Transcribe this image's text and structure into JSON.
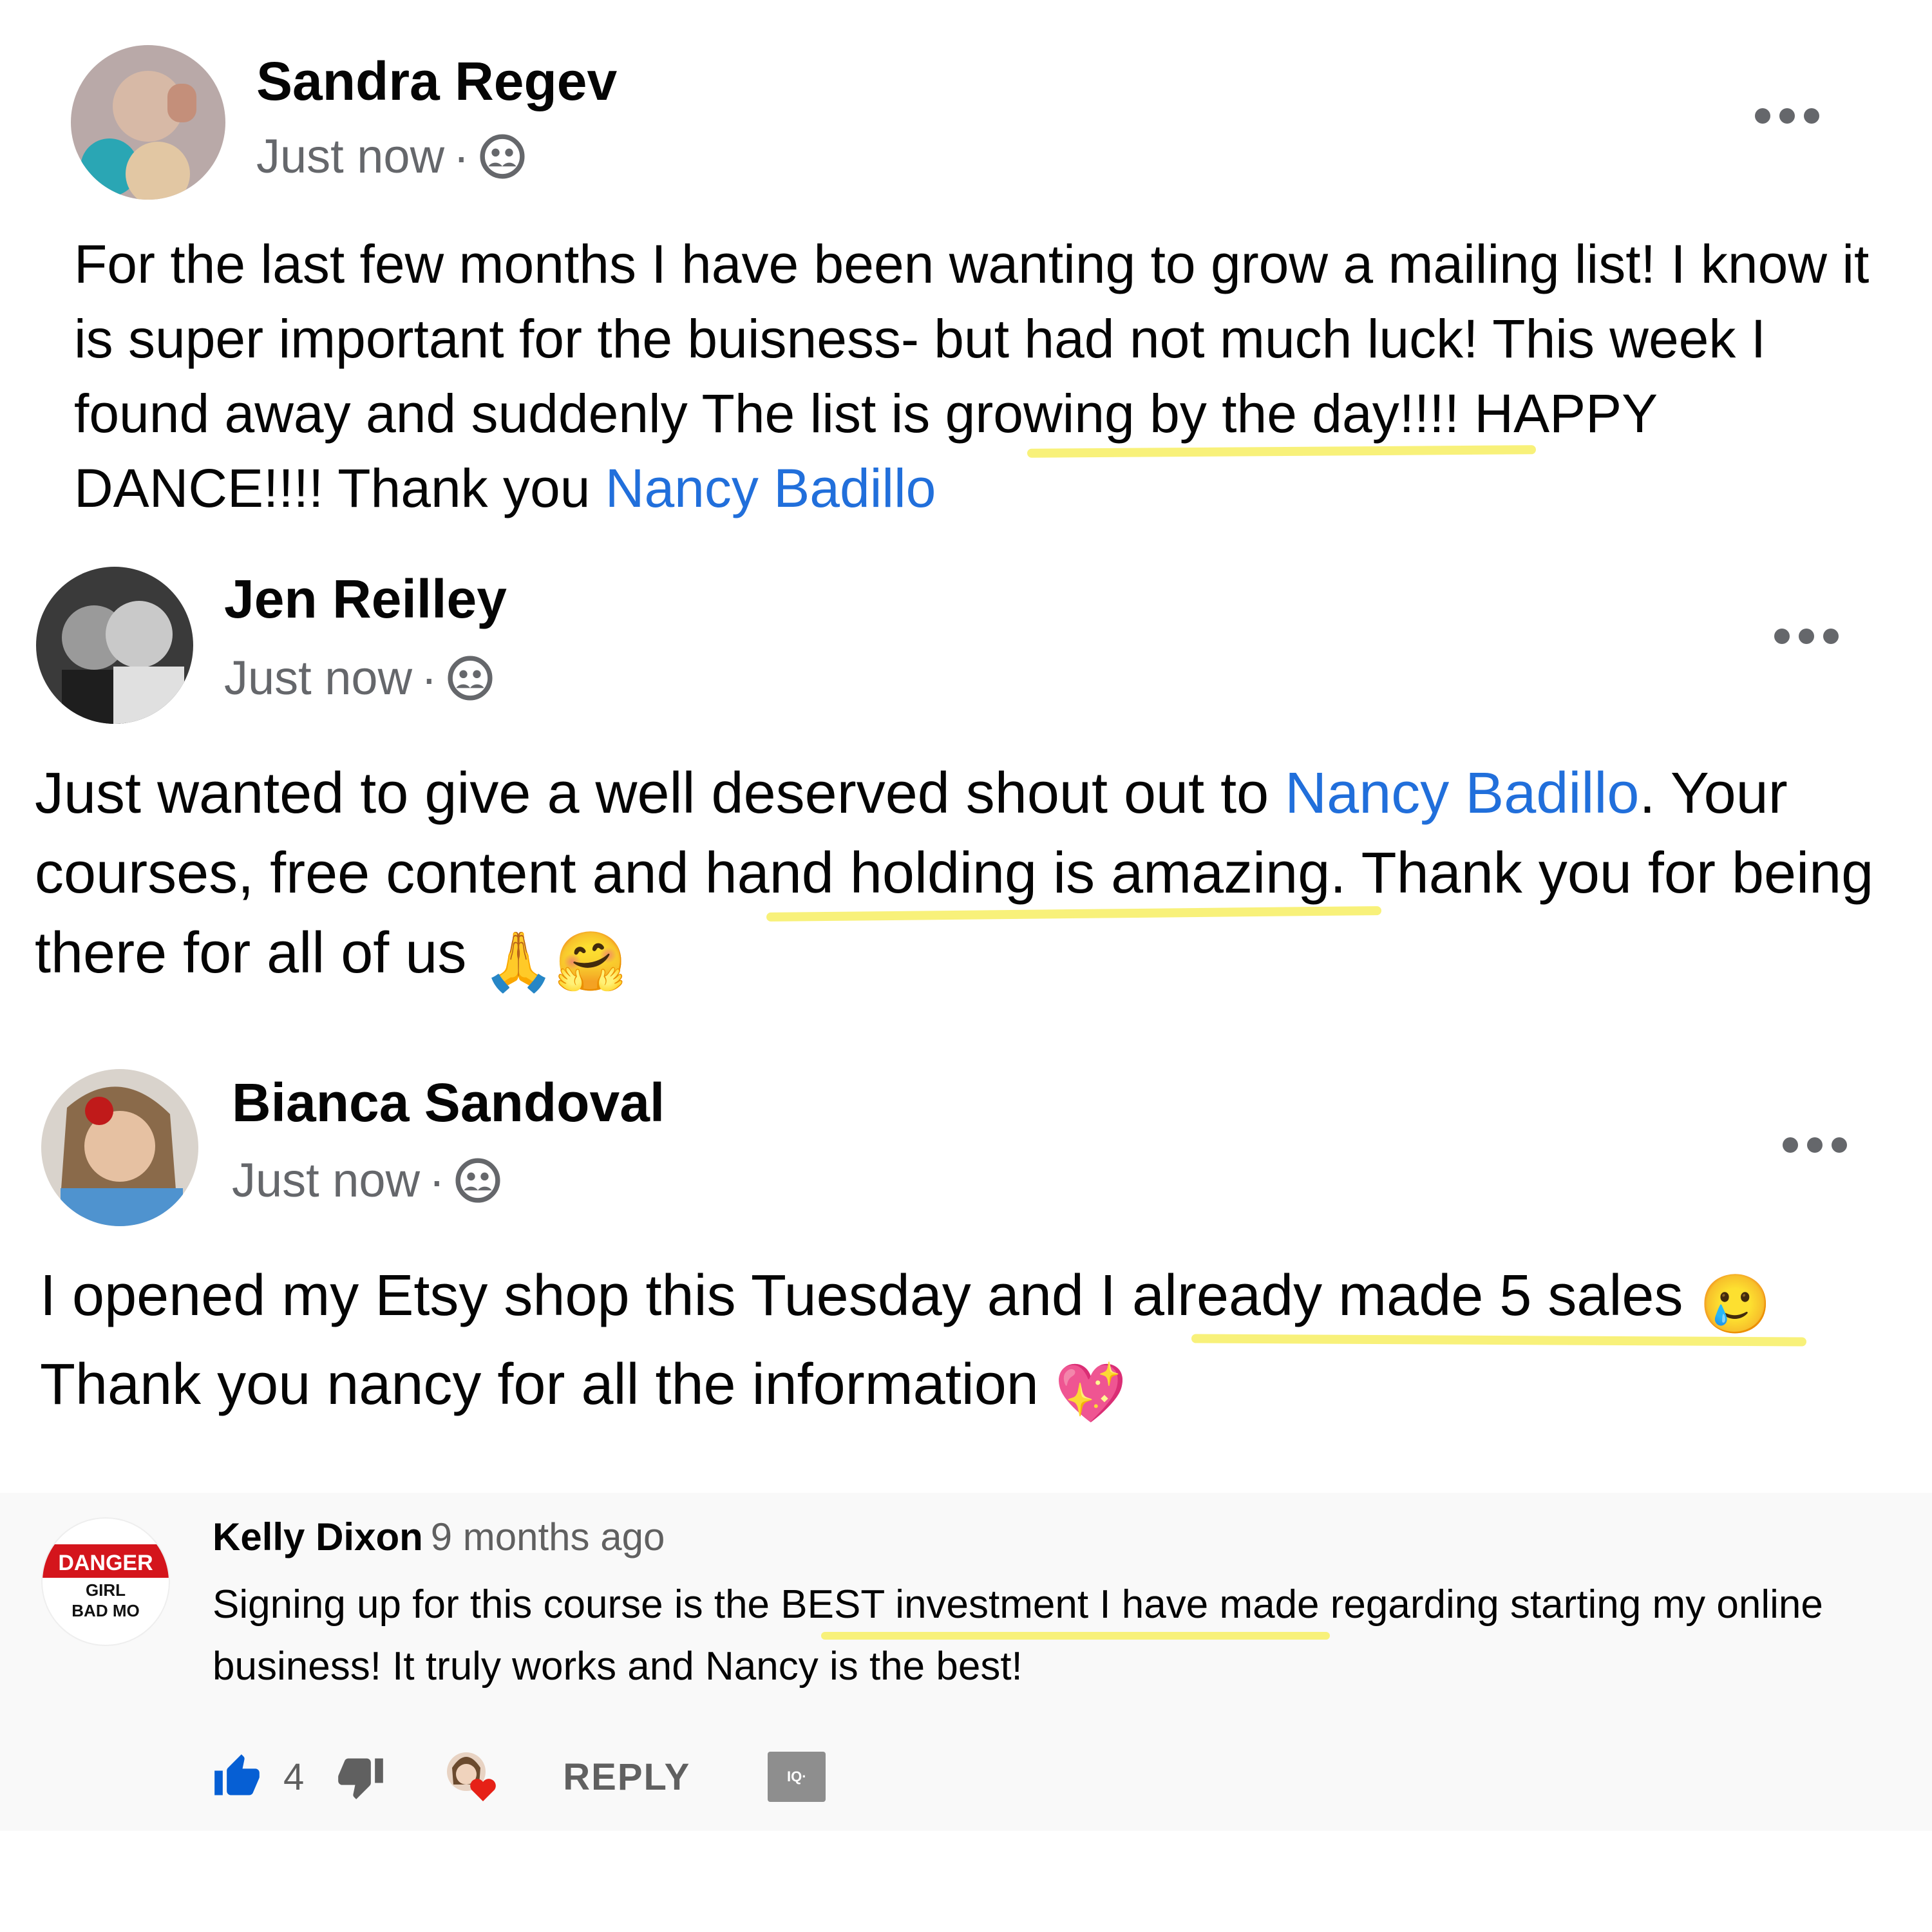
{
  "posts": [
    {
      "author": "Sandra Regev",
      "time": "Just now",
      "separator": "·",
      "privacy_icon": "friends-icon",
      "text_before": "For the last few months I have been wanting to grow a mailing list! I know it is super important for the buisness- but had not much luck! This week I found away and suddenly The list is growing by the day!!!! HAPPY DANCE!!!! Thank you ",
      "mention": "Nancy Badillo",
      "text_after": ""
    },
    {
      "author": "Jen Reilley",
      "time": "Just now",
      "separator": "·",
      "privacy_icon": "friends-icon",
      "text_before": "Just wanted to give a well deserved shout out to ",
      "mention": "Nancy Badillo",
      "text_after": ". Your courses, free content and hand holding is amazing. Thank you for being there for all of us ",
      "emojis": [
        "🙏",
        "🤗"
      ]
    },
    {
      "author": "Bianca Sandoval",
      "time": "Just now",
      "separator": "·",
      "privacy_icon": "friends-icon",
      "text_before": "I opened my Etsy shop this Tuesday and I already made 5 sales ",
      "emoji_mid": "🥲",
      "text_after": " Thank you nancy for all the information ",
      "emoji_end": "💖"
    }
  ],
  "youtube_comment": {
    "author": "Kelly Dixon",
    "time": "9 months ago",
    "avatar_text": [
      "DANGER",
      "GIRL",
      "BAD MO"
    ],
    "text": "Signing up for this course is the BEST investment I have made regarding starting my online business!  It truly works and Nancy is the best!",
    "like_count": "4",
    "reply_label": "REPLY",
    "iq_label": "IQ·"
  },
  "colors": {
    "mention": "#216fdb",
    "highlight": "#f7f06c",
    "like_blue": "#065fd4"
  }
}
